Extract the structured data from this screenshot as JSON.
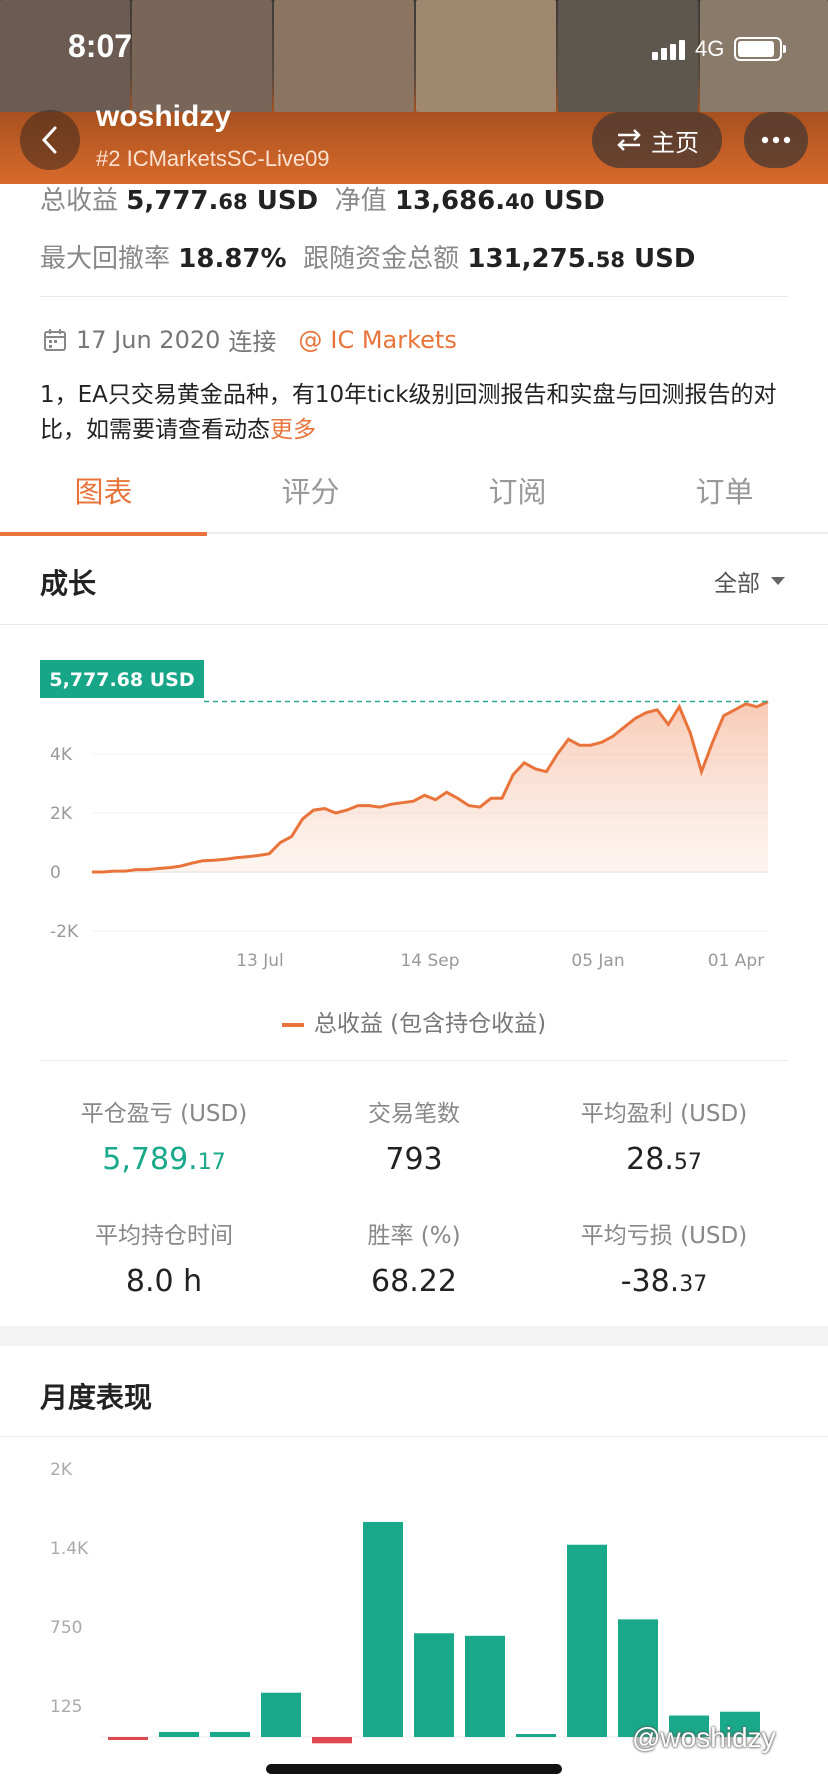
{
  "status": {
    "time": "8:07",
    "network": "4G"
  },
  "header": {
    "title": "woshidzy",
    "subtitle": "#2 ICMarketsSC-Live09",
    "home_label": "主页"
  },
  "stats": {
    "total_profit_label": "总收益",
    "total_profit_int": "5,777.",
    "total_profit_dec": "68",
    "total_profit_unit": "USD",
    "equity_label": "净值",
    "equity_int": "13,686.",
    "equity_dec": "40",
    "equity_unit": "USD",
    "drawdown_label": "最大回撤率",
    "drawdown_value": "18.87%",
    "followers_funds_label": "跟随资金总额",
    "followers_funds_int": "131,275.",
    "followers_funds_dec": "58",
    "followers_funds_unit": "USD"
  },
  "connection": {
    "date": "17 Jun 2020",
    "connect_label": "连接",
    "broker": "IC Markets"
  },
  "description": {
    "text": "1，EA只交易黄金品种，有10年tick级别回测报告和实盘与回测报告的对比，如需要请查看动态",
    "more": "更多"
  },
  "tabs": [
    "图表",
    "评分",
    "订阅",
    "订单"
  ],
  "growth": {
    "title": "成长",
    "range": "全部",
    "current_label": "5,777.68 USD",
    "legend": "总收益 (包含持仓收益)"
  },
  "colors": {
    "accent": "#e8743b",
    "green": "#19a98a",
    "red": "#e0484f"
  },
  "chart_data": [
    {
      "type": "area",
      "y_ticks": [
        "4K",
        "2K",
        "0",
        "-2K"
      ],
      "x_ticks": [
        "13 Jul",
        "14 Sep",
        "05 Jan",
        "01 Apr"
      ],
      "ylim": [
        -2000,
        5800
      ],
      "series": [
        {
          "name": "总收益 (包含持仓收益)",
          "values": [
            0,
            0,
            30,
            30,
            80,
            80,
            120,
            150,
            200,
            300,
            380,
            400,
            430,
            480,
            520,
            560,
            620,
            1000,
            1200,
            1800,
            2100,
            2150,
            2000,
            2100,
            2250,
            2250,
            2200,
            2300,
            2350,
            2400,
            2600,
            2450,
            2700,
            2500,
            2250,
            2200,
            2500,
            2500,
            3300,
            3700,
            3500,
            3400,
            4000,
            4500,
            4300,
            4300,
            4400,
            4600,
            4900,
            5200,
            5400,
            5500,
            5000,
            5600,
            4700,
            3400,
            4400,
            5300,
            5500,
            5700,
            5600,
            5777.68
          ]
        }
      ]
    },
    {
      "type": "bar",
      "y_ticks": [
        "2K",
        "1.4K",
        "750",
        "125"
      ],
      "ylim": [
        0,
        2000
      ],
      "values": [
        -20,
        40,
        40,
        350,
        -50,
        1700,
        820,
        800,
        10,
        1520,
        930,
        170,
        200
      ]
    }
  ],
  "metrics": [
    {
      "label": "平仓盈亏 (USD)",
      "int": "5,789.",
      "dec": "17"
    },
    {
      "label": "交易笔数",
      "int": "793",
      "dec": ""
    },
    {
      "label": "平均盈利 (USD)",
      "int": "28.",
      "dec": "57"
    },
    {
      "label": "平均持仓时间",
      "int": "8.0 h",
      "dec": ""
    },
    {
      "label": "胜率 (%)",
      "int": "68.22",
      "dec": ""
    },
    {
      "label": "平均亏损 (USD)",
      "int": "-38.",
      "dec": "37"
    }
  ],
  "monthly": {
    "title": "月度表现"
  },
  "watermark": "@woshidzy"
}
